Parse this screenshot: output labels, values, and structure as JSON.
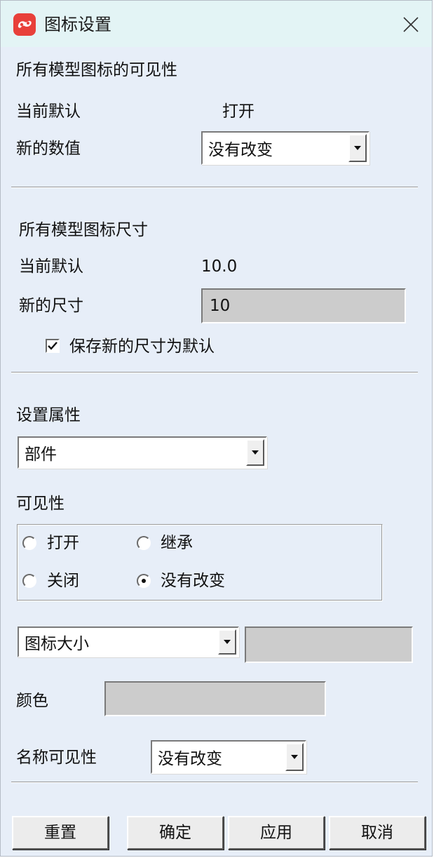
{
  "window": {
    "title": "图标设置",
    "icon": "app-logo-icon",
    "close_icon": "close-icon"
  },
  "visibility_section": {
    "heading": "所有模型图标的可见性",
    "current_label": "当前默认",
    "current_value": "打开",
    "new_label": "新的数值",
    "new_value": "没有改变"
  },
  "size_section": {
    "heading": "所有模型图标尺寸",
    "current_label": "当前默认",
    "current_value": "10.0",
    "new_label": "新的尺寸",
    "new_value": "10",
    "save_default_label": "保存新的尺寸为默认",
    "save_default_checked": true
  },
  "properties": {
    "heading": "设置属性",
    "target_value": "部件",
    "visibility_heading": "可见性",
    "radio_open": "打开",
    "radio_inherit": "继承",
    "radio_close": "关闭",
    "radio_nochange": "没有改变",
    "selected_radio": "没有改变",
    "attribute_select": "图标大小",
    "attribute_value": "",
    "color_label": "颜色",
    "color_value": "",
    "name_visibility_label": "名称可见性",
    "name_visibility_value": "没有改变"
  },
  "buttons": {
    "reset": "重置",
    "ok": "确定",
    "apply": "应用",
    "cancel": "取消"
  },
  "colors": {
    "window_bg": "#e7eef8",
    "titlebar_bg": "#e3f4f5",
    "app_icon": "#e8403a",
    "disabled_field": "#cccccc"
  }
}
